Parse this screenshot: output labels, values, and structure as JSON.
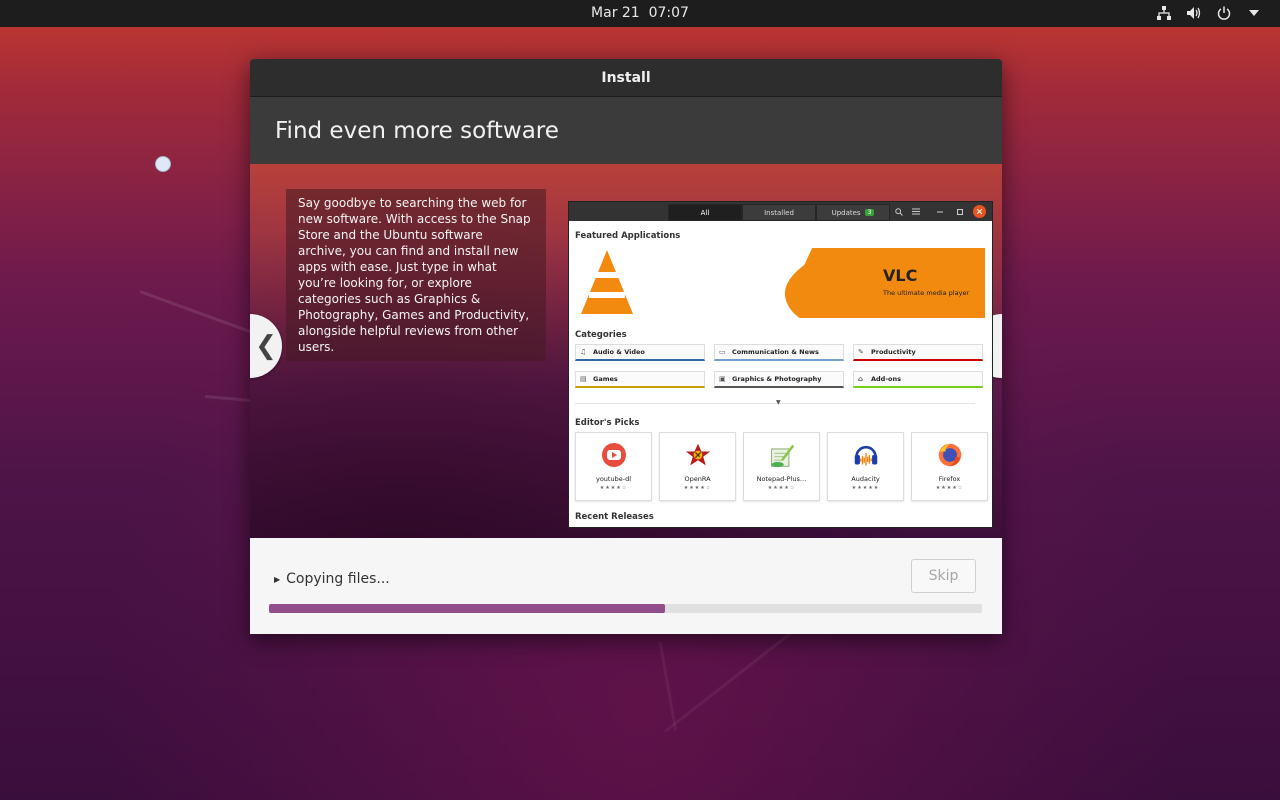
{
  "topbar": {
    "clock": "Mar 21  07:07",
    "tray_icons": [
      "network-icon",
      "volume-icon",
      "power-icon",
      "menu-arrow-icon"
    ]
  },
  "window": {
    "title": "Install",
    "heading": "Find even more software",
    "description": "Say goodbye to searching the web for new software. With access to the Snap Store and the Ubuntu software archive, you can find and install new apps with ease. Just type in what you’re looking for, or explore categories such as Graphics & Photography, Games and Productivity, alongside helpful reviews from other users.",
    "prev_label": "❮",
    "next_label": "❯"
  },
  "store": {
    "tabs": [
      "All",
      "Installed",
      "Updates"
    ],
    "updates_count": "3",
    "featured_title": "Featured Applications",
    "banner_title": "VLC",
    "banner_subtitle": "The ultimate media player",
    "categories_title": "Categories",
    "categories": [
      {
        "label": "Audio & Video",
        "icon": "♫",
        "accent": "#3465a4"
      },
      {
        "label": "Communication & News",
        "icon": "▭",
        "accent": "#729fcf"
      },
      {
        "label": "Productivity",
        "icon": "✎",
        "accent": "#cc0000"
      },
      {
        "label": "Games",
        "icon": "▤",
        "accent": "#c4a000"
      },
      {
        "label": "Graphics & Photography",
        "icon": "▣",
        "accent": "#555753"
      },
      {
        "label": "Add-ons",
        "icon": "⌂",
        "accent": "#73d216"
      }
    ],
    "editors_title": "Editor's Picks",
    "picks": [
      {
        "name": "youtube-dl",
        "stars": "★★★★☆",
        "icon": "youtube-icon"
      },
      {
        "name": "OpenRA",
        "stars": "★★★★☆",
        "icon": "openra-icon"
      },
      {
        "name": "Notepad-Plus…",
        "stars": "★★★★☆",
        "icon": "notepad-icon"
      },
      {
        "name": "Audacity",
        "stars": "★★★★★",
        "icon": "audacity-icon"
      },
      {
        "name": "Firefox",
        "stars": "★★★★☆",
        "icon": "firefox-icon"
      }
    ],
    "recent_title": "Recent Releases"
  },
  "footer": {
    "status": "Copying files...",
    "skip_label": "Skip",
    "progress_fraction": 0.555
  },
  "colors": {
    "accent_purple": "#924d8b",
    "ubuntu_orange": "#e95420"
  }
}
